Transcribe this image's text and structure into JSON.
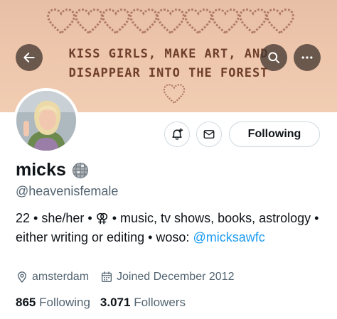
{
  "banner": {
    "line1": "KISS GIRLS, MAKE ART, AND",
    "line2": "DISAPPEAR INTO THE FOREST",
    "heart_count": 9
  },
  "header": {
    "back_icon": "arrow-left-icon",
    "search_icon": "search-icon",
    "more_icon": "more-horizontal-icon"
  },
  "actions": {
    "notify_icon": "bell-plus-icon",
    "message_icon": "envelope-icon",
    "follow_label": "Following"
  },
  "profile": {
    "display_name": "micks",
    "name_emoji_icon": "disco-ball-icon",
    "handle": "@heavenisfemale",
    "bio_text": "22 • she/her • ⚢ • music, tv shows, books, astrology • either writing or editing • woso:",
    "bio_link": "@micksawfc",
    "location": "amsterdam",
    "joined": "Joined December 2012",
    "following_count": "865",
    "following_label": "Following",
    "followers_count": "3.071",
    "followers_label": "Followers"
  },
  "colors": {
    "accent": "#1d9bf0",
    "text": "#0f1419",
    "muted": "#536471",
    "banner": "#eec7ad",
    "banner_text": "#6f3f2c"
  }
}
